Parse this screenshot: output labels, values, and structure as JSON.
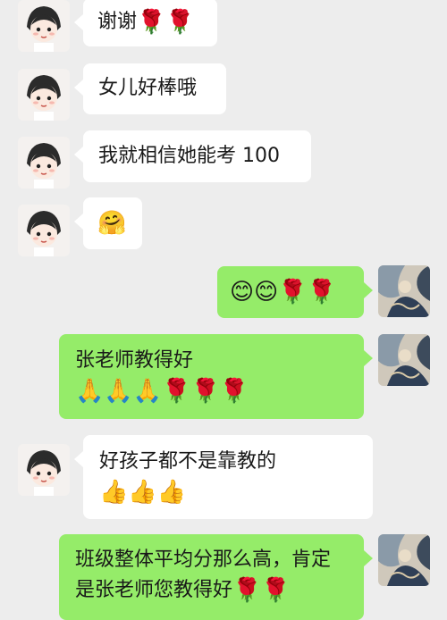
{
  "chat": {
    "messages": [
      {
        "side": "in",
        "text": "谢谢",
        "emoji": "🌹🌹",
        "emoji_names": [
          "rose-icon",
          "rose-icon"
        ]
      },
      {
        "side": "in",
        "text": "女儿好棒哦",
        "emoji": "",
        "emoji_names": []
      },
      {
        "side": "in",
        "text": "我就相信她能考 100",
        "emoji": "",
        "emoji_names": []
      },
      {
        "side": "in",
        "text": "",
        "emoji": "🤗",
        "emoji_names": [
          "hug-face-icon"
        ]
      },
      {
        "side": "out",
        "text": "",
        "emoji": "😊😊🌹🌹",
        "emoji_names": [
          "smile-icon",
          "smile-icon",
          "rose-icon",
          "rose-icon"
        ]
      },
      {
        "side": "out",
        "text": "张老师教得好",
        "emoji": "🙏🙏🙏🌹🌹🌹",
        "emoji_names": [
          "pray-icon",
          "pray-icon",
          "pray-icon",
          "rose-icon",
          "rose-icon",
          "rose-icon"
        ]
      },
      {
        "side": "in",
        "text": "好孩子都不是靠教的",
        "emoji": "👍👍👍",
        "emoji_names": [
          "thumbs-up-icon",
          "thumbs-up-icon",
          "thumbs-up-icon"
        ]
      },
      {
        "side": "out",
        "text": "班级整体平均分那么高，肯定是张老师您教得好",
        "emoji": "🌹🌹",
        "emoji_names": [
          "rose-icon",
          "rose-icon"
        ]
      }
    ]
  },
  "colors": {
    "background": "#ededed",
    "incoming_bubble": "#ffffff",
    "outgoing_bubble": "#95ec69"
  }
}
